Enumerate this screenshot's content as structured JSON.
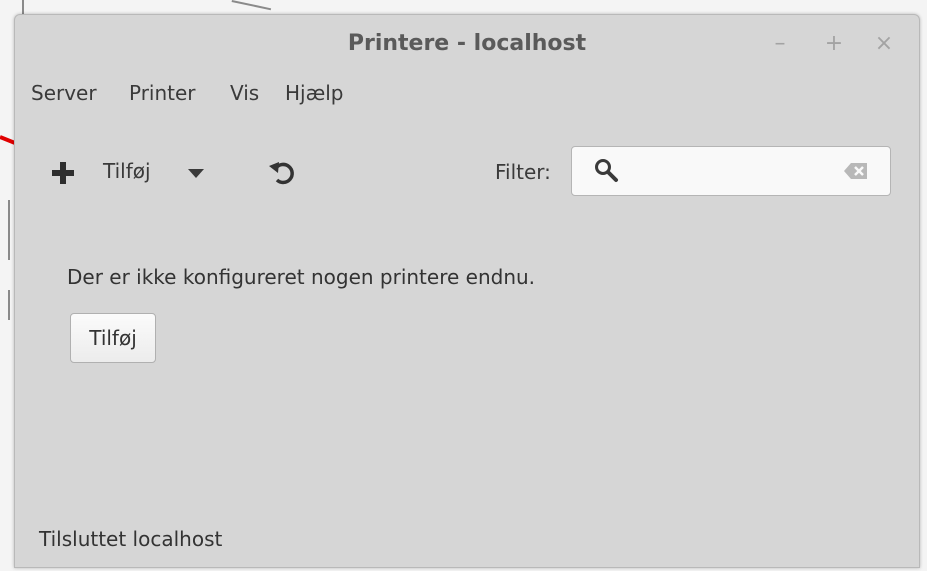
{
  "window": {
    "title": "Printere - localhost",
    "controls": {
      "minimize": "–",
      "maximize": "+",
      "close": "×"
    }
  },
  "menu": {
    "items": [
      {
        "label": "Server"
      },
      {
        "label": "Printer"
      },
      {
        "label": "Vis"
      },
      {
        "label": "Hjælp"
      }
    ]
  },
  "toolbar": {
    "add_label": "Tilføj",
    "add_icon": "plus-icon",
    "dropdown_icon": "caret-down-icon",
    "refresh_icon": "refresh-icon",
    "filter_label": "Filter:",
    "filter_value": "",
    "filter_search_icon": "search-icon",
    "filter_clear_icon": "clear-text-icon"
  },
  "content": {
    "empty_message": "Der er ikke konfigureret nogen printere endnu.",
    "add_button_label": "Tilføj"
  },
  "status": {
    "text": "Tilsluttet localhost"
  },
  "colors": {
    "window_bg": "#d6d6d6",
    "title_text": "#5a5a5a",
    "annotation_arrow": "#e00000"
  }
}
